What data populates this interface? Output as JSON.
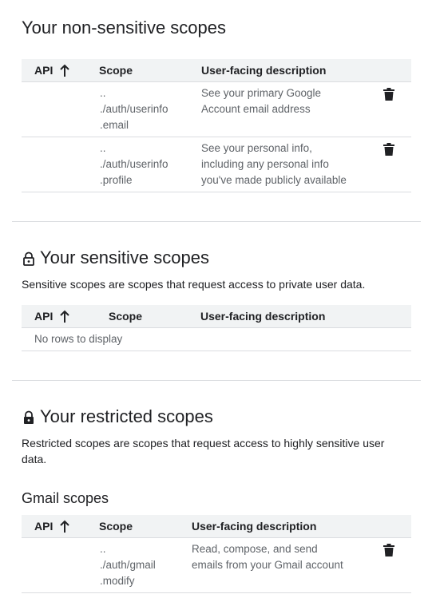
{
  "nonsensitive": {
    "title": "Your non-sensitive scopes",
    "columns": [
      "API",
      "Scope",
      "User-facing description"
    ],
    "rows": [
      {
        "scope_l1": "..",
        "scope_l2": "./auth/userinfo",
        "scope_l3": ".email",
        "desc_l1": "See your primary Google",
        "desc_l2": "Account email address",
        "desc_l3": ""
      },
      {
        "scope_l1": "..",
        "scope_l2": "./auth/userinfo",
        "scope_l3": ".profile",
        "desc_l1": "See your personal info,",
        "desc_l2": "including any personal info",
        "desc_l3": "you've made publicly available"
      }
    ]
  },
  "sensitive": {
    "title": "Your sensitive scopes",
    "description": "Sensitive scopes are scopes that request access to private user data.",
    "columns": [
      "API",
      "Scope",
      "User-facing description"
    ],
    "empty_text": "No rows to display"
  },
  "restricted": {
    "title": "Your restricted scopes",
    "description_l1": "Restricted scopes are scopes that request access to highly sensitive user",
    "description_l2": "data.",
    "gmail": {
      "title": "Gmail scopes",
      "columns": [
        "API",
        "Scope",
        "User-facing description"
      ],
      "rows": [
        {
          "scope_l1": "..",
          "scope_l2": "./auth/gmail",
          "scope_l3": ".modify",
          "desc_l1": "Read, compose, and send",
          "desc_l2": "emails from your Gmail account"
        }
      ]
    }
  },
  "icons": {
    "sort": "arrow-up-icon",
    "delete": "trash-icon",
    "lock_open": "lock-open-icon",
    "lock": "lock-icon"
  }
}
